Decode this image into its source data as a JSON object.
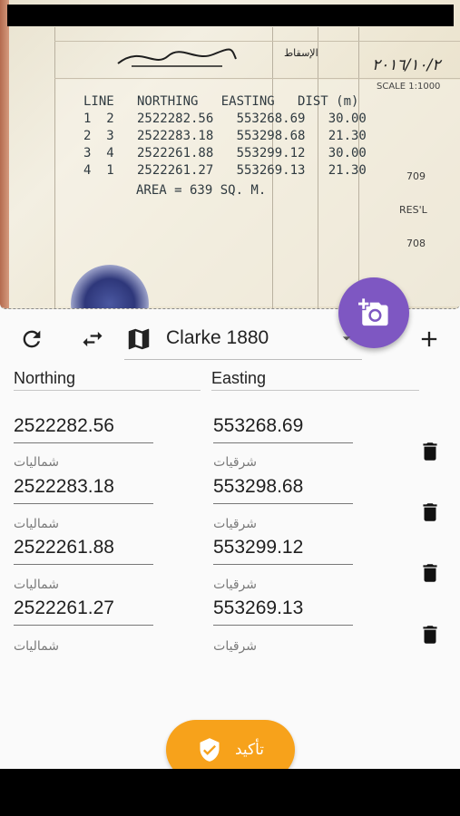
{
  "photo": {
    "header_scribble": "الإسقاط",
    "date_handwritten": "٢٠١٦/١٠/٢",
    "scale_text": "SCALE 1:1000",
    "table_header": "LINE   NORTHING   EASTING   DIST (m)",
    "rows": [
      "1  2   2522282.56   553268.69   30.00",
      "2  3   2522283.18   553298.68   21.30",
      "3  4   2522261.88   553299.12   30.00",
      "4  1   2522261.27   553269.13   21.30"
    ],
    "area_text": "AREA = 639 SQ. M.",
    "side_labels": [
      "709",
      "RES'L",
      "708"
    ]
  },
  "fab": {
    "icon": "add-photo-icon"
  },
  "toolbar": {
    "refresh_icon": "refresh-icon",
    "swap_icon": "swap-horiz-icon",
    "map_icon": "map-icon",
    "datum_value": "Clarke 1880",
    "dropdown_icon": "arrow-drop-down-icon",
    "add_icon": "add-icon"
  },
  "columns": {
    "northing": "Northing",
    "easting": "Easting"
  },
  "rows": [
    {
      "northing": "2522282.56",
      "easting": "553268.69",
      "northing_helper": "شماليات",
      "easting_helper": "شرقيات"
    },
    {
      "northing": "2522283.18",
      "easting": "553298.68",
      "northing_helper": "شماليات",
      "easting_helper": "شرقيات"
    },
    {
      "northing": "2522261.88",
      "easting": "553299.12",
      "northing_helper": "شماليات",
      "easting_helper": "شرقيات"
    },
    {
      "northing": "2522261.27",
      "easting": "553269.13",
      "northing_helper": "شماليات",
      "easting_helper": "شرقيات"
    }
  ],
  "confirm": {
    "label": "تأكيد",
    "icon": "verified-shield-icon"
  },
  "colors": {
    "fab": "#7e57c2",
    "confirm": "#f7a21b",
    "background": "#fafafa"
  }
}
